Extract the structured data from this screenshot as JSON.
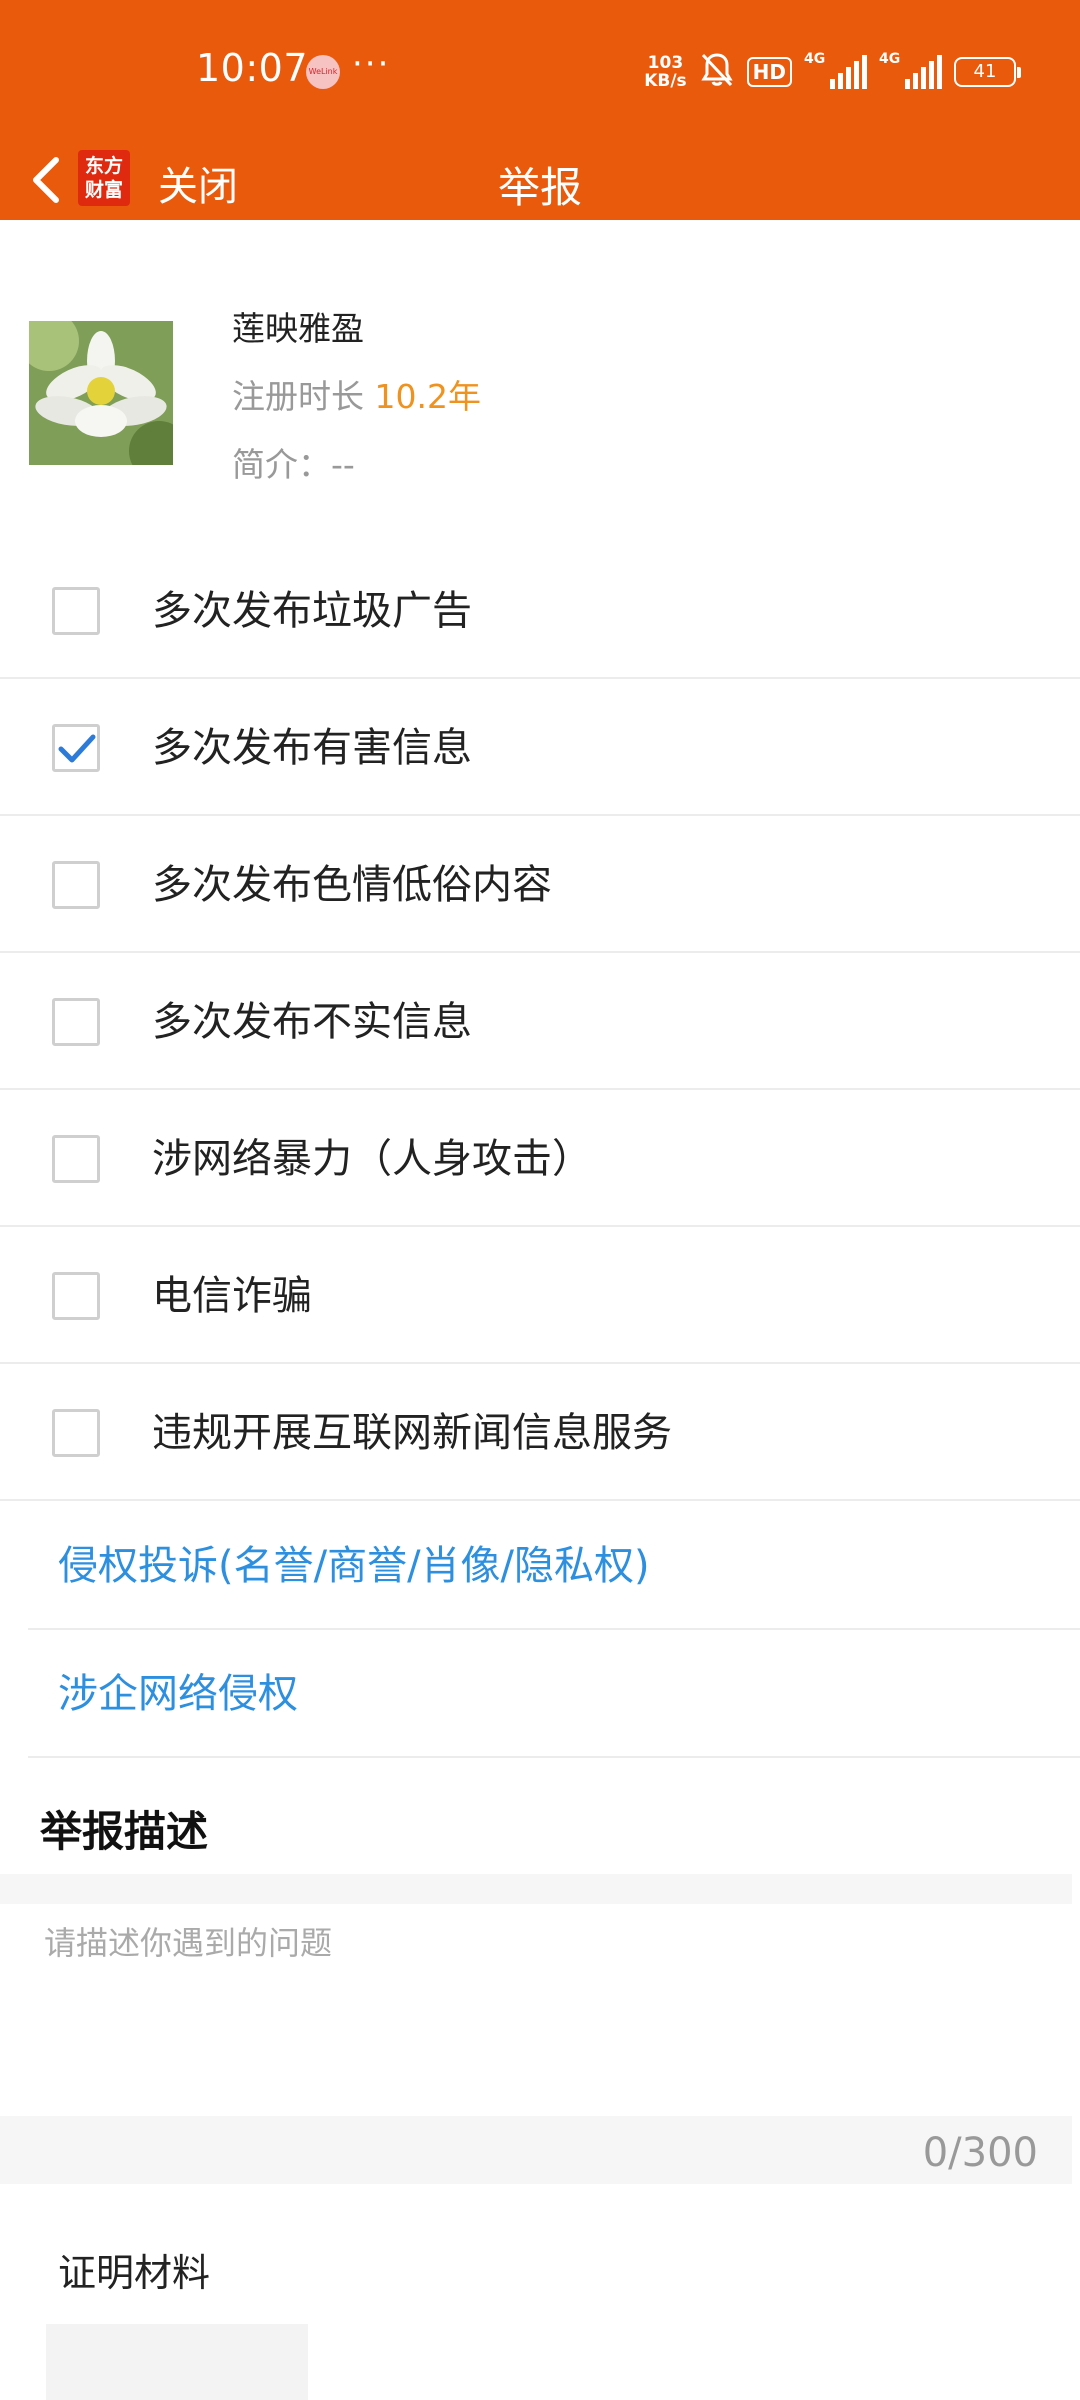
{
  "status_bar": {
    "time": "10:07",
    "notification_app": "WeLink",
    "more": "···",
    "net_speed_value": "103",
    "net_speed_unit": "KB/s",
    "hd": "HD",
    "net1": "4G",
    "net2": "4G",
    "battery": "41"
  },
  "nav": {
    "logo_line1": "东方",
    "logo_line2": "财富",
    "close_label": "关闭",
    "title": "举报"
  },
  "user": {
    "name": "莲映雅盈",
    "reg_label": "注册时长",
    "reg_value": "10.2年",
    "bio_label": "简介：",
    "bio_value": "--"
  },
  "options": [
    {
      "label": "多次发布垃圾广告",
      "checked": false
    },
    {
      "label": "多次发布有害信息",
      "checked": true
    },
    {
      "label": "多次发布色情低俗内容",
      "checked": false
    },
    {
      "label": "多次发布不实信息",
      "checked": false
    },
    {
      "label": "涉网络暴力（人身攻击）",
      "checked": false
    },
    {
      "label": "电信诈骗",
      "checked": false
    },
    {
      "label": "违规开展互联网新闻信息服务",
      "checked": false
    }
  ],
  "links": [
    {
      "label": "侵权投诉(名誉/商誉/肖像/隐私权)"
    },
    {
      "label": "涉企网络侵权"
    }
  ],
  "description": {
    "title": "举报描述",
    "placeholder": "请描述你遇到的问题",
    "counter": "0/300"
  },
  "proof": {
    "title": "证明材料"
  },
  "colors": {
    "brand": "#E95A0C",
    "link": "#2D8FE0",
    "highlight": "#F0921E",
    "check": "#2D7BD8"
  }
}
